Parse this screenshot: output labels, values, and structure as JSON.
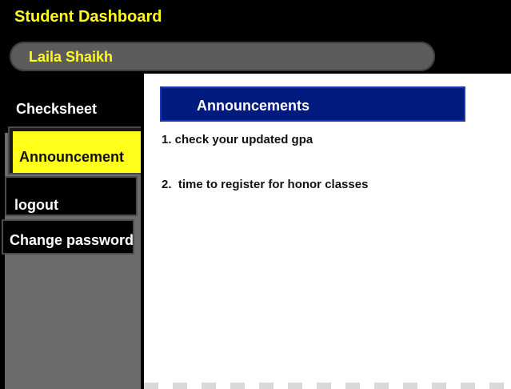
{
  "app": {
    "title": "Student Dashboard"
  },
  "user": {
    "name": "Laila Shaikh"
  },
  "sidebar": {
    "items": [
      {
        "label": "Checksheet",
        "active": false
      },
      {
        "label": "Announcement",
        "active": true
      },
      {
        "label": "logout",
        "active": false
      },
      {
        "label": "Change password",
        "active": false
      }
    ]
  },
  "main": {
    "heading": "Announcements",
    "announcements": [
      "1. check your updated gpa",
      "2.  time to register for honor classes"
    ]
  },
  "colors": {
    "accent": "#ffff1a",
    "heading_bar": "#001a80",
    "background": "#000000",
    "content": "#ffffff",
    "sidebar_fill": "#6b6b6b"
  }
}
